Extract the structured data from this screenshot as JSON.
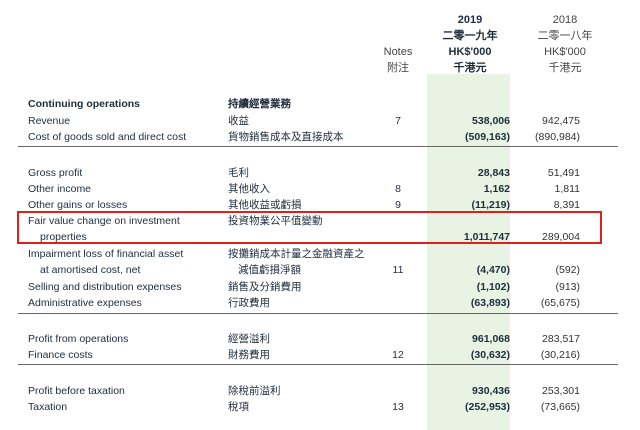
{
  "header": {
    "year_2019": "2019",
    "year_2019_cn": "二零一九年",
    "currency_2019": "HK$'000",
    "currency_2019_cn": "千港元",
    "year_2018": "2018",
    "year_2018_cn": "二零一八年",
    "currency_2018": "HK$'000",
    "currency_2018_cn": "千港元",
    "notes": "Notes",
    "notes_cn": "附注"
  },
  "rows": [
    {
      "en": "Continuing operations",
      "cn": "持續經營業務",
      "note": "",
      "v2019": "",
      "v2018": ""
    },
    {
      "en": "Revenue",
      "cn": "收益",
      "note": "7",
      "v2019": "538,006",
      "v2018": "942,475"
    },
    {
      "en": "Cost of goods sold and direct cost",
      "cn": "貨物銷售成本及直接成本",
      "note": "",
      "v2019": "(509,163)",
      "v2018": "(890,984)"
    },
    {
      "en": "Gross profit",
      "cn": "毛利",
      "note": "",
      "v2019": "28,843",
      "v2018": "51,491"
    },
    {
      "en": "Other income",
      "cn": "其他收入",
      "note": "8",
      "v2019": "1,162",
      "v2018": "1,811"
    },
    {
      "en": "Other gains or losses",
      "cn": "其他收益或虧損",
      "note": "9",
      "v2019": "(11,219)",
      "v2018": "8,391"
    },
    {
      "en": "Fair value change on investment",
      "cn": "投資物業公平值變動",
      "note": "",
      "v2019": "",
      "v2018": ""
    },
    {
      "en": "properties",
      "cn": "",
      "note": "",
      "v2019": "1,011,747",
      "v2018": "289,004"
    },
    {
      "en": "Impairment loss of financial asset",
      "cn": "按攤銷成本計量之金融資產之",
      "note": "",
      "v2019": "",
      "v2018": ""
    },
    {
      "en": "at amortised cost, net",
      "cn": "減值虧損淨額",
      "note": "11",
      "v2019": "(4,470)",
      "v2018": "(592)"
    },
    {
      "en": "Selling and distribution expenses",
      "cn": "銷售及分銷費用",
      "note": "",
      "v2019": "(1,102)",
      "v2018": "(913)"
    },
    {
      "en": "Administrative expenses",
      "cn": "行政費用",
      "note": "",
      "v2019": "(63,893)",
      "v2018": "(65,675)"
    },
    {
      "en": "Profit from operations",
      "cn": "經營溢利",
      "note": "",
      "v2019": "961,068",
      "v2018": "283,517"
    },
    {
      "en": "Finance costs",
      "cn": "財務費用",
      "note": "12",
      "v2019": "(30,632)",
      "v2018": "(30,216)"
    },
    {
      "en": "Profit before taxation",
      "cn": "除稅前溢利",
      "note": "",
      "v2019": "930,436",
      "v2018": "253,301"
    },
    {
      "en": "Taxation",
      "cn": "稅項",
      "note": "13",
      "v2019": "(252,953)",
      "v2018": "(73,665)"
    }
  ]
}
